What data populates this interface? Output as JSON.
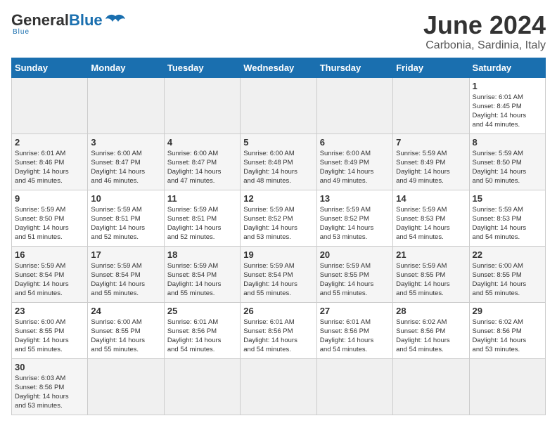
{
  "header": {
    "logo_general": "General",
    "logo_blue": "Blue",
    "logo_subtitle": "Blue",
    "month_title": "June 2024",
    "subtitle": "Carbonia, Sardinia, Italy"
  },
  "weekdays": [
    "Sunday",
    "Monday",
    "Tuesday",
    "Wednesday",
    "Thursday",
    "Friday",
    "Saturday"
  ],
  "weeks": [
    [
      {
        "day": "",
        "info": ""
      },
      {
        "day": "",
        "info": ""
      },
      {
        "day": "",
        "info": ""
      },
      {
        "day": "",
        "info": ""
      },
      {
        "day": "",
        "info": ""
      },
      {
        "day": "",
        "info": ""
      },
      {
        "day": "1",
        "info": "Sunrise: 6:01 AM\nSunset: 8:45 PM\nDaylight: 14 hours\nand 44 minutes."
      }
    ],
    [
      {
        "day": "2",
        "info": "Sunrise: 6:01 AM\nSunset: 8:46 PM\nDaylight: 14 hours\nand 45 minutes."
      },
      {
        "day": "3",
        "info": "Sunrise: 6:00 AM\nSunset: 8:47 PM\nDaylight: 14 hours\nand 46 minutes."
      },
      {
        "day": "4",
        "info": "Sunrise: 6:00 AM\nSunset: 8:47 PM\nDaylight: 14 hours\nand 47 minutes."
      },
      {
        "day": "5",
        "info": "Sunrise: 6:00 AM\nSunset: 8:48 PM\nDaylight: 14 hours\nand 48 minutes."
      },
      {
        "day": "6",
        "info": "Sunrise: 6:00 AM\nSunset: 8:49 PM\nDaylight: 14 hours\nand 49 minutes."
      },
      {
        "day": "7",
        "info": "Sunrise: 5:59 AM\nSunset: 8:49 PM\nDaylight: 14 hours\nand 49 minutes."
      },
      {
        "day": "8",
        "info": "Sunrise: 5:59 AM\nSunset: 8:50 PM\nDaylight: 14 hours\nand 50 minutes."
      }
    ],
    [
      {
        "day": "9",
        "info": "Sunrise: 5:59 AM\nSunset: 8:50 PM\nDaylight: 14 hours\nand 51 minutes."
      },
      {
        "day": "10",
        "info": "Sunrise: 5:59 AM\nSunset: 8:51 PM\nDaylight: 14 hours\nand 52 minutes."
      },
      {
        "day": "11",
        "info": "Sunrise: 5:59 AM\nSunset: 8:51 PM\nDaylight: 14 hours\nand 52 minutes."
      },
      {
        "day": "12",
        "info": "Sunrise: 5:59 AM\nSunset: 8:52 PM\nDaylight: 14 hours\nand 53 minutes."
      },
      {
        "day": "13",
        "info": "Sunrise: 5:59 AM\nSunset: 8:52 PM\nDaylight: 14 hours\nand 53 minutes."
      },
      {
        "day": "14",
        "info": "Sunrise: 5:59 AM\nSunset: 8:53 PM\nDaylight: 14 hours\nand 54 minutes."
      },
      {
        "day": "15",
        "info": "Sunrise: 5:59 AM\nSunset: 8:53 PM\nDaylight: 14 hours\nand 54 minutes."
      }
    ],
    [
      {
        "day": "16",
        "info": "Sunrise: 5:59 AM\nSunset: 8:54 PM\nDaylight: 14 hours\nand 54 minutes."
      },
      {
        "day": "17",
        "info": "Sunrise: 5:59 AM\nSunset: 8:54 PM\nDaylight: 14 hours\nand 55 minutes."
      },
      {
        "day": "18",
        "info": "Sunrise: 5:59 AM\nSunset: 8:54 PM\nDaylight: 14 hours\nand 55 minutes."
      },
      {
        "day": "19",
        "info": "Sunrise: 5:59 AM\nSunset: 8:54 PM\nDaylight: 14 hours\nand 55 minutes."
      },
      {
        "day": "20",
        "info": "Sunrise: 5:59 AM\nSunset: 8:55 PM\nDaylight: 14 hours\nand 55 minutes."
      },
      {
        "day": "21",
        "info": "Sunrise: 5:59 AM\nSunset: 8:55 PM\nDaylight: 14 hours\nand 55 minutes."
      },
      {
        "day": "22",
        "info": "Sunrise: 6:00 AM\nSunset: 8:55 PM\nDaylight: 14 hours\nand 55 minutes."
      }
    ],
    [
      {
        "day": "23",
        "info": "Sunrise: 6:00 AM\nSunset: 8:55 PM\nDaylight: 14 hours\nand 55 minutes."
      },
      {
        "day": "24",
        "info": "Sunrise: 6:00 AM\nSunset: 8:55 PM\nDaylight: 14 hours\nand 55 minutes."
      },
      {
        "day": "25",
        "info": "Sunrise: 6:01 AM\nSunset: 8:56 PM\nDaylight: 14 hours\nand 54 minutes."
      },
      {
        "day": "26",
        "info": "Sunrise: 6:01 AM\nSunset: 8:56 PM\nDaylight: 14 hours\nand 54 minutes."
      },
      {
        "day": "27",
        "info": "Sunrise: 6:01 AM\nSunset: 8:56 PM\nDaylight: 14 hours\nand 54 minutes."
      },
      {
        "day": "28",
        "info": "Sunrise: 6:02 AM\nSunset: 8:56 PM\nDaylight: 14 hours\nand 54 minutes."
      },
      {
        "day": "29",
        "info": "Sunrise: 6:02 AM\nSunset: 8:56 PM\nDaylight: 14 hours\nand 53 minutes."
      }
    ],
    [
      {
        "day": "30",
        "info": "Sunrise: 6:03 AM\nSunset: 8:56 PM\nDaylight: 14 hours\nand 53 minutes."
      },
      {
        "day": "",
        "info": ""
      },
      {
        "day": "",
        "info": ""
      },
      {
        "day": "",
        "info": ""
      },
      {
        "day": "",
        "info": ""
      },
      {
        "day": "",
        "info": ""
      },
      {
        "day": "",
        "info": ""
      }
    ]
  ]
}
